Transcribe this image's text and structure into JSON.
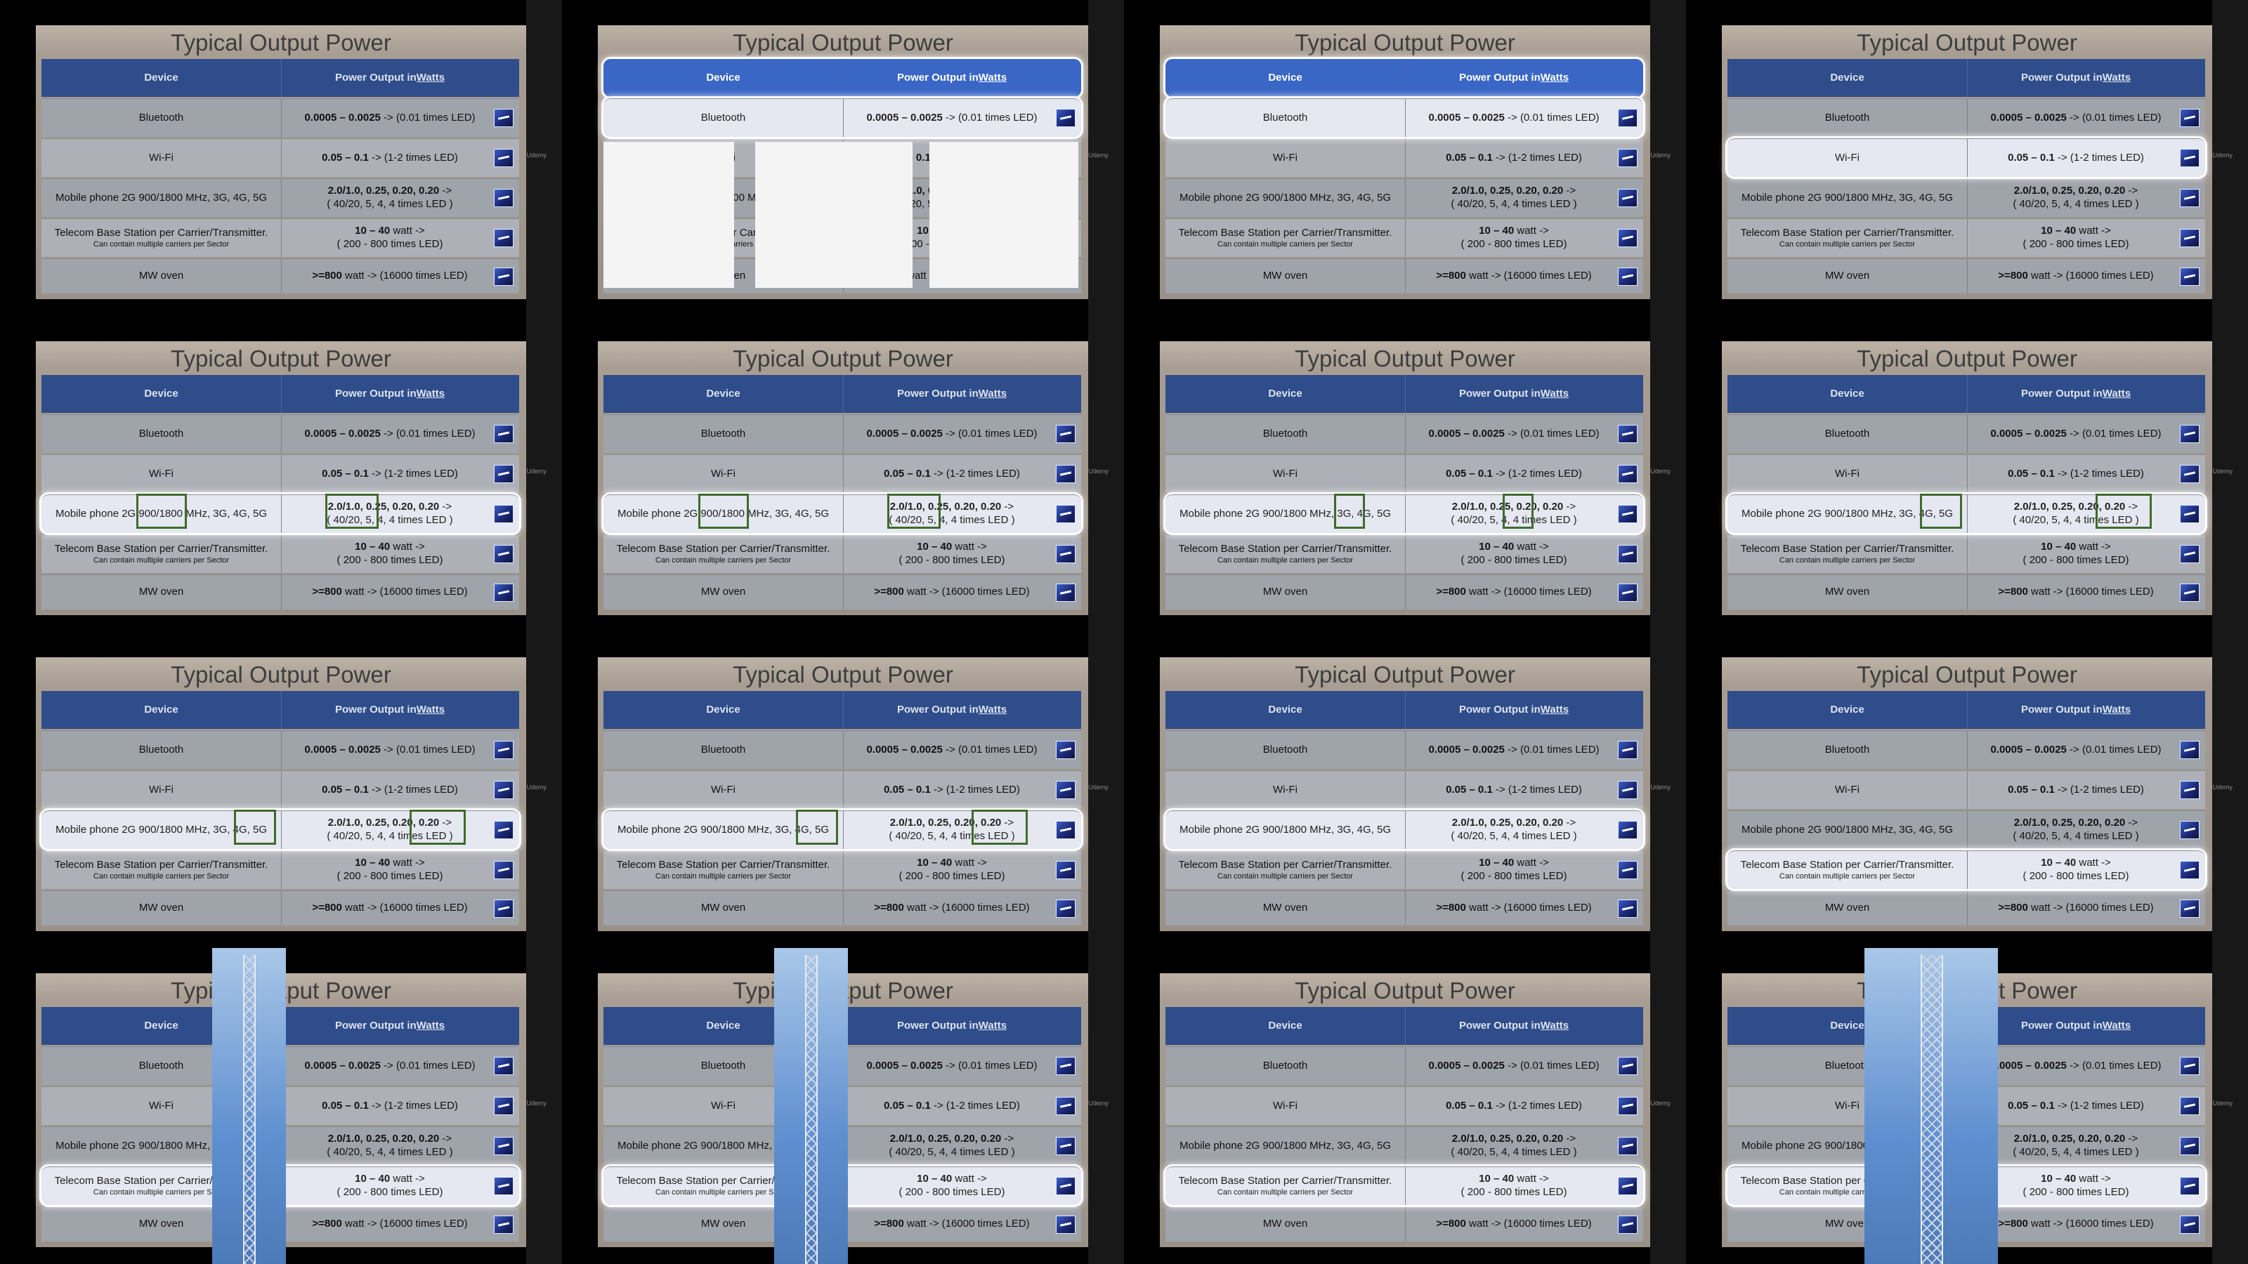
{
  "slide": {
    "title": "Typical Output Power",
    "header": {
      "device": "Device",
      "power_prefix": "Power Output in ",
      "power_unit": "Watts"
    },
    "rows": [
      {
        "device": "Bluetooth",
        "power_bold": "0.0005 – 0.0025",
        "power_rest": " -> (0.01 times LED)"
      },
      {
        "device": "Wi-Fi",
        "power_bold": "0.05 – 0.1",
        "power_rest": " -> (1-2 times LED)"
      },
      {
        "device": "Mobile phone 2G 900/1800 MHz, 3G, 4G, 5G",
        "power_bold": "2.0/1.0, 0.25, 0.20, 0.20",
        "power_rest": " ->",
        "power_line2": "( 40/20, 5,  4, 4  times LED )"
      },
      {
        "device": "Telecom Base Station per Carrier/Transmitter.",
        "device_sub": "Can contain multiple carriers per Sector",
        "power_bold": "10 – 40",
        "power_rest": " watt ->",
        "power_line2": "( 200 - 800 times LED)"
      },
      {
        "device": "MW oven",
        "power_bold": ">=800",
        "power_rest": " watt -> (16000 times LED)"
      }
    ],
    "watermark": "Udemy"
  },
  "frames": [
    {
      "highlight": "none",
      "overlay": "none"
    },
    {
      "highlight": "header+bluetooth",
      "overlay": "bluetooth-devices"
    },
    {
      "highlight": "header+bluetooth",
      "overlay": "none"
    },
    {
      "highlight": "wifi",
      "overlay": "none"
    },
    {
      "highlight": "mobile",
      "overlay": "box-2g"
    },
    {
      "highlight": "mobile",
      "overlay": "box-2g"
    },
    {
      "highlight": "mobile",
      "overlay": "box-3g"
    },
    {
      "highlight": "mobile",
      "overlay": "box-4g"
    },
    {
      "highlight": "mobile",
      "overlay": "box-4g5g"
    },
    {
      "highlight": "mobile",
      "overlay": "box-4g5g"
    },
    {
      "highlight": "mobile",
      "overlay": "none"
    },
    {
      "highlight": "telecom",
      "overlay": "none"
    },
    {
      "highlight": "telecom",
      "overlay": "tower"
    },
    {
      "highlight": "telecom",
      "overlay": "tower"
    },
    {
      "highlight": "telecom",
      "overlay": "none"
    },
    {
      "highlight": "telecom",
      "overlay": "tower-wide"
    }
  ]
}
